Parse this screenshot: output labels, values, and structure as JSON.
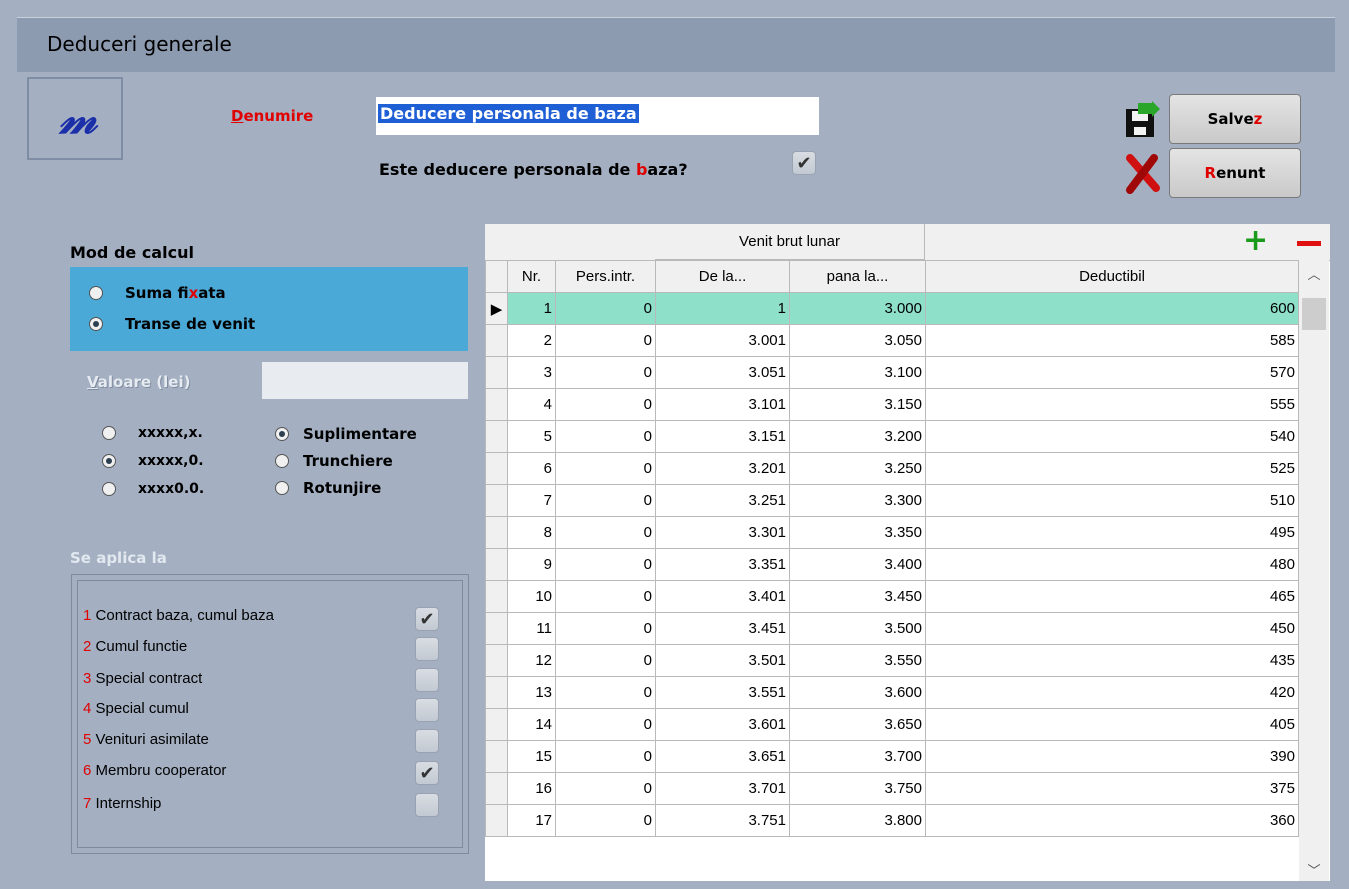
{
  "window": {
    "title": "Deduceri generale"
  },
  "logo": {
    "text": "m"
  },
  "form": {
    "denumire_label_prefix": "D",
    "denumire_label_rest": "enumire",
    "denumire_value": "Deducere personala de baza",
    "este_label_a": "Este deducere personala de ",
    "este_label_hot": "b",
    "este_label_b": "aza?",
    "este_checked": "✔"
  },
  "buttons": {
    "save_a": "Salve",
    "save_hot": "z",
    "cancel_hot": "R",
    "cancel_b": "enunt"
  },
  "mod_calcul": {
    "title": "Mod de calcul",
    "opt1_a": "Suma fi",
    "opt1_hot": "x",
    "opt1_b": "ata",
    "opt2": "Transe de venit",
    "selected": "Transe de venit"
  },
  "valoare": {
    "label_hot": "V",
    "label_rest": "aloare (lei)",
    "value": ""
  },
  "rounding": {
    "format_opts": [
      "xxxxx,x.",
      "xxxxx,0.",
      "xxxx0.0."
    ],
    "format_selected": "xxxxx,0.",
    "mode_opts": [
      "Suplimentare",
      "Trunchiere",
      "Rotunjire"
    ],
    "mode_selected": "Suplimentare"
  },
  "aplica": {
    "title": "Se aplica la",
    "items": [
      {
        "num": "1",
        "label": "Contract baza, cumul baza",
        "checked": "✔"
      },
      {
        "num": "2",
        "label": "Cumul functie",
        "checked": ""
      },
      {
        "num": "3",
        "label": "Special contract",
        "checked": ""
      },
      {
        "num": "4",
        "label": "Special cumul",
        "checked": ""
      },
      {
        "num": "5",
        "label": "Venituri asimilate",
        "checked": ""
      },
      {
        "num": "6",
        "label": "Membru cooperator",
        "checked": "✔"
      },
      {
        "num": "7",
        "label": "Internship",
        "checked": ""
      }
    ]
  },
  "grid": {
    "group_header": "Venit brut lunar",
    "columns": [
      "Nr.",
      "Pers.intr.",
      "De la...",
      "pana la...",
      "Deductibil"
    ],
    "rows": [
      [
        "1",
        "0",
        "1",
        "3.000",
        "600"
      ],
      [
        "2",
        "0",
        "3.001",
        "3.050",
        "585"
      ],
      [
        "3",
        "0",
        "3.051",
        "3.100",
        "570"
      ],
      [
        "4",
        "0",
        "3.101",
        "3.150",
        "555"
      ],
      [
        "5",
        "0",
        "3.151",
        "3.200",
        "540"
      ],
      [
        "6",
        "0",
        "3.201",
        "3.250",
        "525"
      ],
      [
        "7",
        "0",
        "3.251",
        "3.300",
        "510"
      ],
      [
        "8",
        "0",
        "3.301",
        "3.350",
        "495"
      ],
      [
        "9",
        "0",
        "3.351",
        "3.400",
        "480"
      ],
      [
        "10",
        "0",
        "3.401",
        "3.450",
        "465"
      ],
      [
        "11",
        "0",
        "3.451",
        "3.500",
        "450"
      ],
      [
        "12",
        "0",
        "3.501",
        "3.550",
        "435"
      ],
      [
        "13",
        "0",
        "3.551",
        "3.600",
        "420"
      ],
      [
        "14",
        "0",
        "3.601",
        "3.650",
        "405"
      ],
      [
        "15",
        "0",
        "3.651",
        "3.700",
        "390"
      ],
      [
        "16",
        "0",
        "3.701",
        "3.750",
        "375"
      ],
      [
        "17",
        "0",
        "3.751",
        "3.800",
        "360"
      ]
    ],
    "add_icon": "+",
    "remove_icon": "−"
  },
  "colors": {
    "accent": "#4aa9d6",
    "selected_row": "#8fe0c8",
    "hotkey": "#e00000"
  }
}
